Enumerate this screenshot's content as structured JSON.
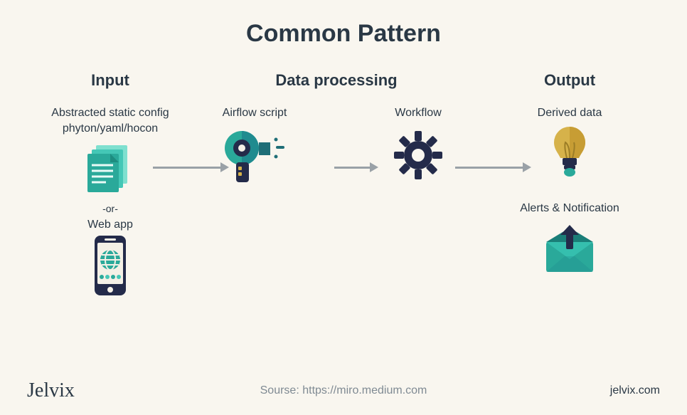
{
  "title": "Common Pattern",
  "columns": {
    "input": {
      "heading": "Input",
      "config_label_l1": "Abstracted static config",
      "config_label_l2": "phyton/yaml/hocon",
      "or": "-or-",
      "webapp_label": "Web app"
    },
    "processing": {
      "heading": "Data processing",
      "airflow_label": "Airflow script",
      "workflow_label": "Workflow"
    },
    "output": {
      "heading": "Output",
      "derived_label": "Derived data",
      "alerts_label": "Alerts & Notification"
    }
  },
  "footer": {
    "logo": "Jelvix",
    "source_prefix": "Sourse: ",
    "source_url": "https://miro.medium.com",
    "site": "jelvix.com"
  }
}
